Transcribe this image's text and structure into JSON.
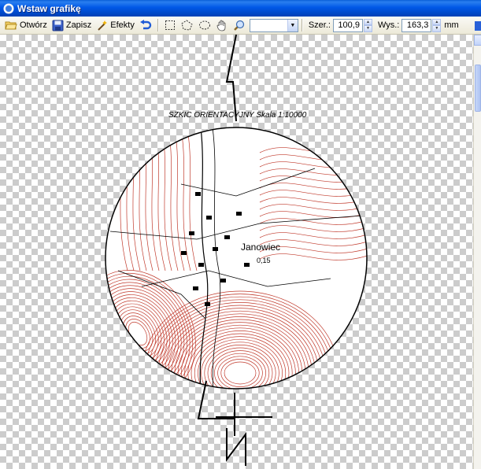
{
  "window": {
    "title": "Wstaw grafikę"
  },
  "toolbar": {
    "open_label": "Otwórz",
    "save_label": "Zapisz",
    "effects_label": "Efekty",
    "combo_value": "",
    "width_label": "Szer.:",
    "width_value": "100,9",
    "height_label": "Wys.:",
    "height_value": "163,3",
    "unit": "mm"
  },
  "icons": [
    "folder-open-icon",
    "save-disk-icon",
    "magic-wand-icon",
    "undo-icon",
    "rect-select-icon",
    "lasso-select-icon",
    "ellipse-select-icon",
    "hand-icon",
    "zoom-icon"
  ],
  "map": {
    "title": "SZKIC ORIENTACYJNY Skala 1:10000",
    "place_name": "Janowiec",
    "place_value": "0,15",
    "contour_color": "#c0392b",
    "line_color": "#000000"
  }
}
